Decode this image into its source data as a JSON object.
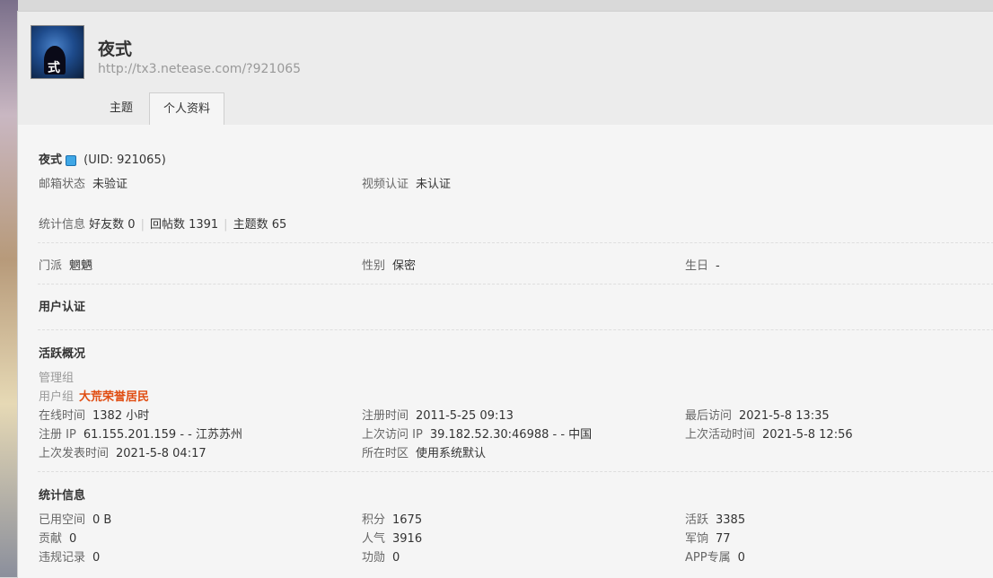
{
  "header": {
    "username": "夜式",
    "site_url": "http://tx3.netease.com/?921065",
    "avatar_text": "式",
    "tabs": [
      {
        "label": "主题",
        "active": false
      },
      {
        "label": "个人资料",
        "active": true
      }
    ]
  },
  "profile": {
    "name": "夜式",
    "uid_text": "(UID: 921065)",
    "email_label": "邮箱状态",
    "email_value": "未验证",
    "video_label": "视频认证",
    "video_value": "未认证",
    "stats_label": "统计信息",
    "friends": "好友数 0",
    "replies": "回帖数 1391",
    "threads": "主题数 65",
    "sect_label": "门派",
    "sect_value": "魍魉",
    "gender_label": "性别",
    "gender_value": "保密",
    "birthday_label": "生日",
    "birthday_value": "-"
  },
  "auth": {
    "title": "用户认证"
  },
  "activity": {
    "title": "活跃概况",
    "admin_group_label": "管理组",
    "user_group_label": "用户组",
    "user_group_value": "大荒荣誉居民",
    "online_label": "在线时间",
    "online_value": "1382 小时",
    "reg_time_label": "注册时间",
    "reg_time_value": "2011-5-25 09:13",
    "last_visit_label": "最后访问",
    "last_visit_value": "2021-5-8 13:35",
    "reg_ip_label": "注册 IP",
    "reg_ip_value": "61.155.201.159 - - 江苏苏州",
    "last_ip_label": "上次访问 IP",
    "last_ip_value": "39.182.52.30:46988 - - 中国",
    "last_active_label": "上次活动时间",
    "last_active_value": "2021-5-8 12:56",
    "last_post_label": "上次发表时间",
    "last_post_value": "2021-5-8 04:17",
    "timezone_label": "所在时区",
    "timezone_value": "使用系统默认"
  },
  "statistics": {
    "title": "统计信息",
    "space_label": "已用空间",
    "space_value": "0 B",
    "points_label": "积分",
    "points_value": "1675",
    "active_label": "活跃",
    "active_value": "3385",
    "contrib_label": "贡献",
    "contrib_value": "0",
    "popularity_label": "人气",
    "popularity_value": "3916",
    "pay_label": "军饷",
    "pay_value": "77",
    "violation_label": "违规记录",
    "violation_value": "0",
    "merit_label": "功勋",
    "merit_value": "0",
    "app_label": "APP专属",
    "app_value": "0"
  },
  "colors": {
    "user_group": "#e04d12",
    "panel_bg": "#f5f5f5",
    "header_bg": "#ececec"
  }
}
